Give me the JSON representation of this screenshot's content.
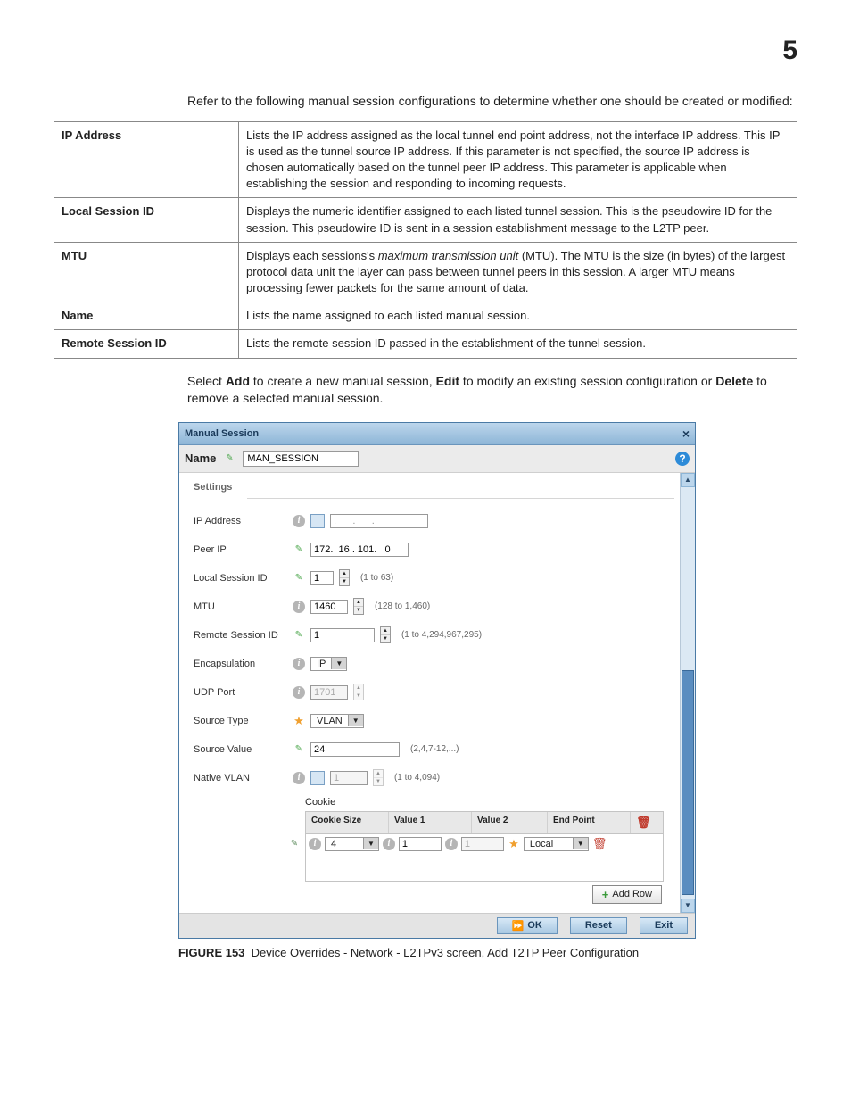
{
  "page_number": "5",
  "intro_text": " Refer to the following manual session configurations to determine whether one should be created or modified:",
  "table": [
    {
      "label": "IP Address",
      "desc": "Lists the IP address assigned as the local tunnel end point address, not the interface IP address. This IP is used as the tunnel source IP address. If this parameter is not specified, the source IP address is chosen automatically based on the tunnel peer IP address. This parameter is applicable when establishing the session and responding to incoming requests."
    },
    {
      "label": "Local Session ID",
      "desc": "Displays the numeric identifier assigned to each listed tunnel session. This is the pseudowire ID for the session. This pseudowire ID is sent in a session establishment message to the L2TP peer."
    },
    {
      "label": "MTU",
      "desc_pre": "Displays each sessions's ",
      "desc_em": "maximum transmission unit",
      "desc_post": " (MTU). The MTU is the size (in bytes) of the largest protocol data unit the layer can pass between tunnel peers in this session. A larger MTU means processing fewer packets for the same amount of data."
    },
    {
      "label": "Name",
      "desc": "Lists the name assigned to each listed manual session."
    },
    {
      "label": "Remote Session ID",
      "desc": "Lists the remote session ID passed in the establishment of the tunnel session."
    }
  ],
  "para": {
    "pre": "Select ",
    "b1": "Add",
    "mid1": " to create a new manual session, ",
    "b2": "Edit",
    "mid2": " to modify an existing session configuration or ",
    "b3": "Delete",
    "post": " to remove a selected manual session."
  },
  "dialog": {
    "title": "Manual Session",
    "close": "×",
    "name_label": "Name",
    "name_value": "MAN_SESSION",
    "help": "?",
    "settings_label": "Settings",
    "fields": {
      "ip_address": {
        "label": "IP Address",
        "value": ".      .      ."
      },
      "peer_ip": {
        "label": "Peer IP",
        "value": "172.  16 . 101.   0"
      },
      "local_session_id": {
        "label": "Local Session ID",
        "value": "1",
        "hint": "(1 to 63)"
      },
      "mtu": {
        "label": "MTU",
        "value": "1460",
        "hint": "(128 to 1,460)"
      },
      "remote_session_id": {
        "label": "Remote Session ID",
        "value": "1",
        "hint": "(1 to 4,294,967,295)"
      },
      "encapsulation": {
        "label": "Encapsulation",
        "value": "IP"
      },
      "udp_port": {
        "label": "UDP Port",
        "value": "1701"
      },
      "source_type": {
        "label": "Source Type",
        "value": "VLAN"
      },
      "source_value": {
        "label": "Source Value",
        "value": "24",
        "hint": "(2,4,7-12,...)"
      },
      "native_vlan": {
        "label": "Native VLAN",
        "value": "1",
        "hint": "(1 to 4,094)"
      }
    },
    "cookie_label": "Cookie",
    "cookie_table": {
      "headers": [
        "Cookie Size",
        "Value 1",
        "Value 2",
        "End Point"
      ],
      "row": {
        "cookie_size": "4",
        "value1": "1",
        "value2": "1",
        "end_point": "Local"
      }
    },
    "add_row": "Add Row",
    "footer": {
      "ok": "OK",
      "reset": "Reset",
      "exit": "Exit"
    }
  },
  "caption": {
    "fig": "FIGURE 153",
    "text": "Device Overrides - Network - L2TPv3 screen, Add T2TP Peer Configuration"
  }
}
